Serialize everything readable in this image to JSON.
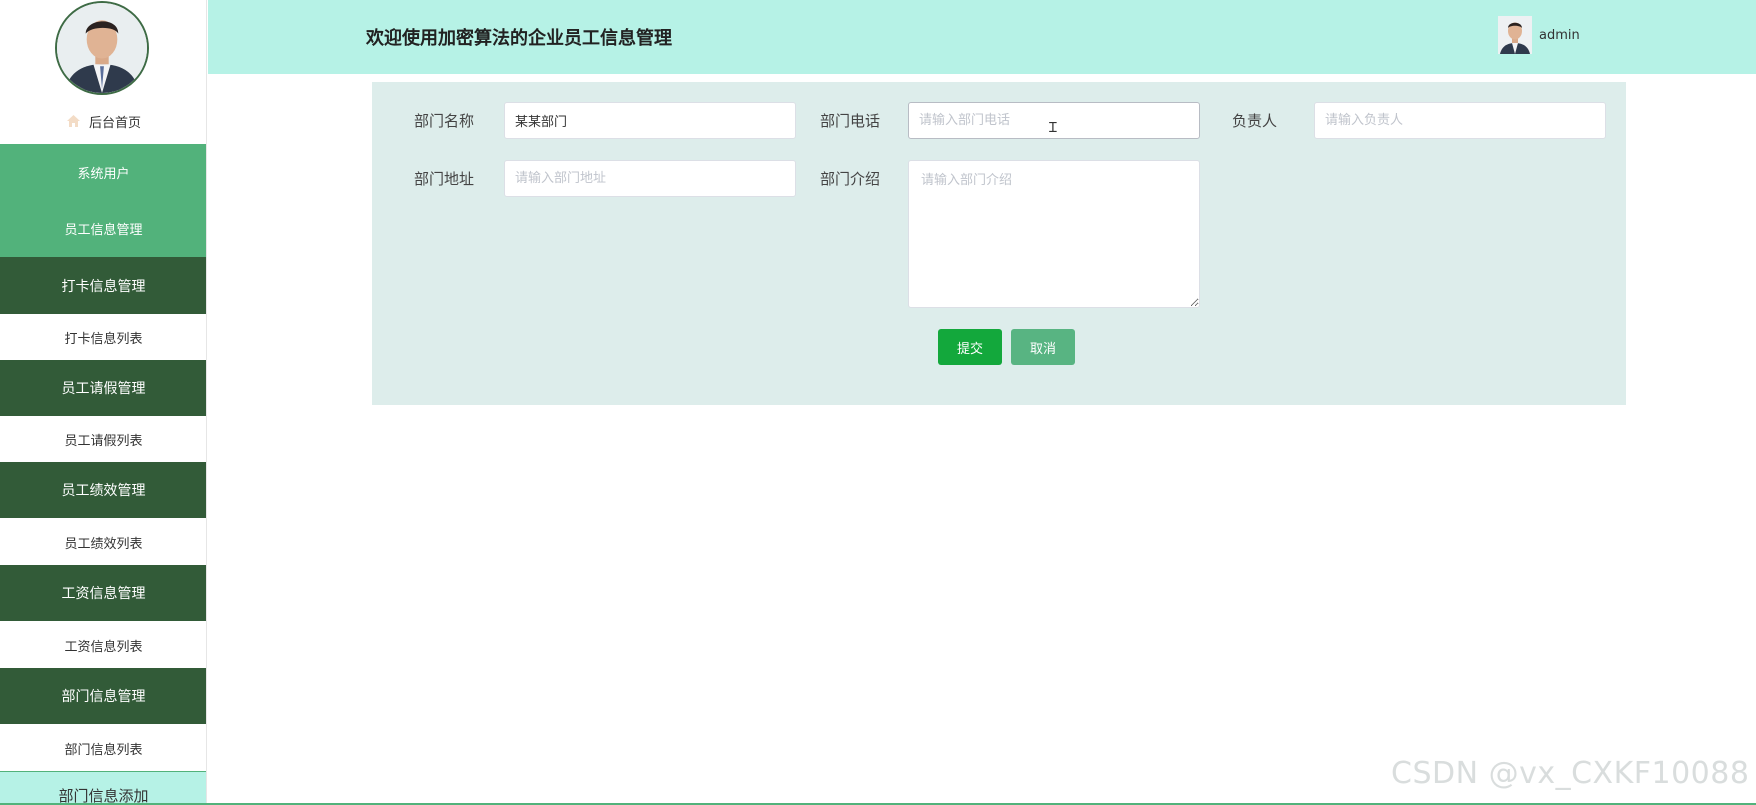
{
  "user": {
    "name": "admin"
  },
  "header": {
    "title": "欢迎使用加密算法的企业员工信息管理"
  },
  "sidebar": {
    "home_label": "后台首页",
    "items": [
      {
        "label": "系统用户",
        "style": "light"
      },
      {
        "label": "员工信息管理",
        "style": "light"
      },
      {
        "label": "打卡信息管理",
        "style": "dark"
      },
      {
        "label": "打卡信息列表",
        "style": "sub"
      },
      {
        "label": "员工请假管理",
        "style": "dark"
      },
      {
        "label": "员工请假列表",
        "style": "sub"
      },
      {
        "label": "员工绩效管理",
        "style": "dark"
      },
      {
        "label": "员工绩效列表",
        "style": "sub"
      },
      {
        "label": "工资信息管理",
        "style": "dark"
      },
      {
        "label": "工资信息列表",
        "style": "sub"
      },
      {
        "label": "部门信息管理",
        "style": "dark"
      },
      {
        "label": "部门信息列表",
        "style": "sub"
      },
      {
        "label": "部门信息添加",
        "style": "active"
      }
    ]
  },
  "form": {
    "dept_name": {
      "label": "部门名称",
      "value": "某某部门",
      "placeholder": ""
    },
    "dept_phone": {
      "label": "部门电话",
      "value": "",
      "placeholder": "请输入部门电话"
    },
    "manager": {
      "label": "负责人",
      "value": "",
      "placeholder": "请输入负责人"
    },
    "dept_address": {
      "label": "部门地址",
      "value": "",
      "placeholder": "请输入部门地址"
    },
    "dept_intro": {
      "label": "部门介绍",
      "value": "",
      "placeholder": "请输入部门介绍"
    },
    "submit_label": "提交",
    "cancel_label": "取消"
  },
  "watermark": "CSDN @vx_CXKF10088",
  "colors": {
    "header_bg": "#b6f2e6",
    "menu_light": "#52b27b",
    "menu_dark": "#325b38",
    "panel_bg": "#ddedeb",
    "submit": "#13a83c",
    "cancel": "#58b482"
  }
}
